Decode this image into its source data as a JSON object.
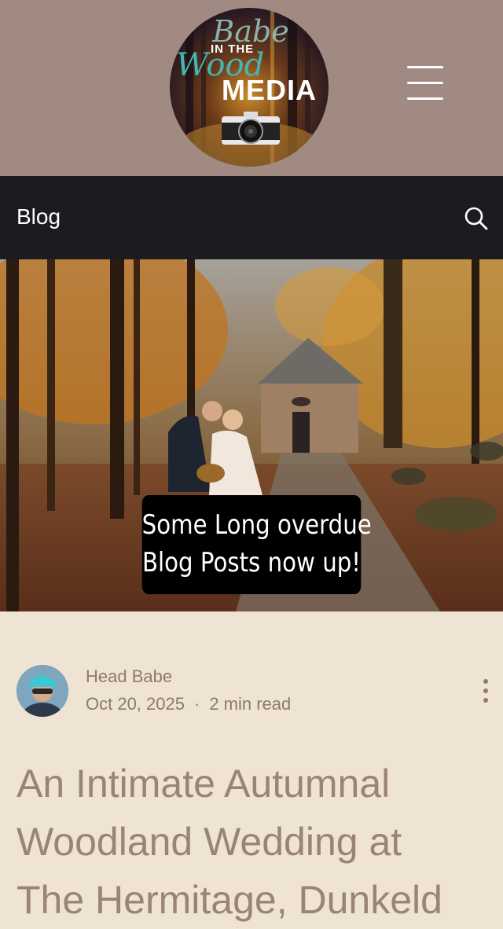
{
  "header": {
    "logo": {
      "line1": "Babe",
      "line2": "IN THE",
      "line3": "Wood",
      "line4": "MEDIA"
    },
    "menu_icon": "hamburger-menu-icon"
  },
  "nav": {
    "title": "Blog",
    "search_icon": "search-icon"
  },
  "hero": {
    "caption_line1": "Some Long overdue",
    "caption_line2": "Blog Posts now up!"
  },
  "post": {
    "author": "Head Babe",
    "date": "Oct 20, 2025",
    "separator": "·",
    "read_time": "2 min read",
    "more_icon": "more-vertical-icon",
    "title_lines": [
      "An Intimate Autumnal",
      "Woodland Wedding at",
      "The Hermitage, Dunkeld"
    ]
  },
  "colors": {
    "header_bg": "#a08a81",
    "nav_bg": "#1c1b1f",
    "page_bg": "#efe3d3",
    "meta_text": "#8d7a6c",
    "title_text": "#9a8476",
    "logo_teal": "#45b5b3"
  }
}
